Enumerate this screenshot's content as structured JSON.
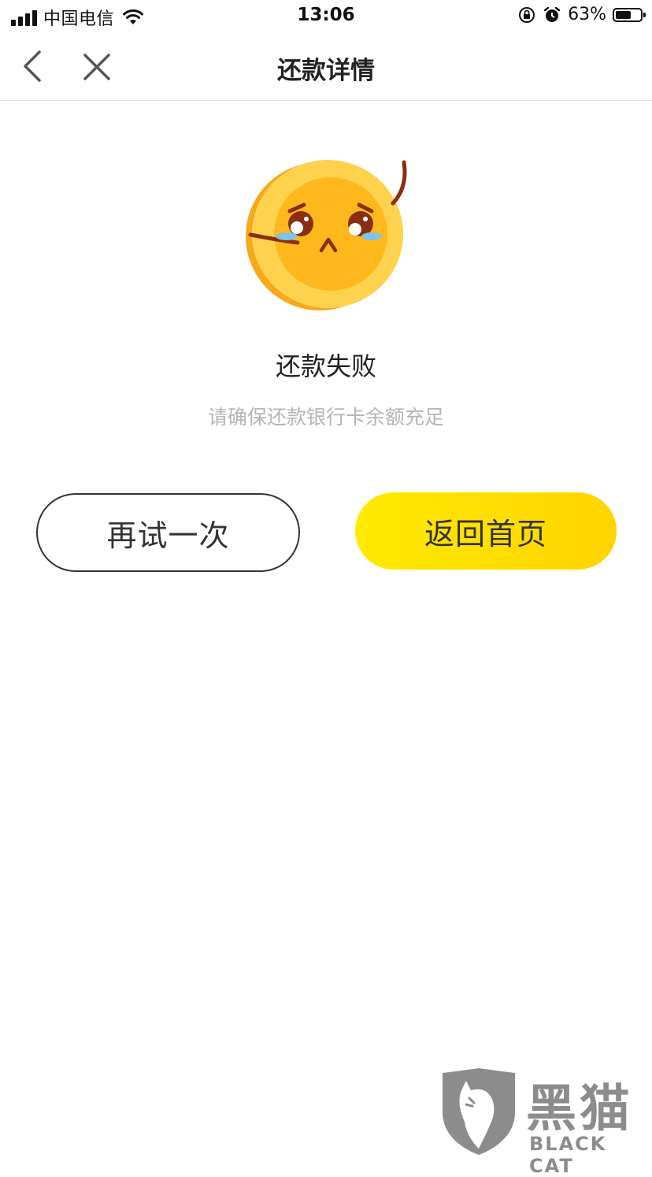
{
  "status_bar": {
    "carrier": "中国电信",
    "time": "13:06",
    "battery_percent": "63%",
    "battery_level": 0.63,
    "icons": [
      "signal-icon",
      "wifi-icon",
      "orientation-lock-icon",
      "alarm-icon",
      "battery-icon"
    ]
  },
  "nav": {
    "title": "还款详情",
    "back_icon": "chevron-left-icon",
    "close_icon": "close-icon"
  },
  "result": {
    "illustration": "crying-coin-icon",
    "title": "还款失败",
    "subtitle": "请确保还款银行卡余额充足"
  },
  "actions": {
    "retry_label": "再试一次",
    "home_label": "返回首页"
  },
  "watermark": {
    "text": "黑猫",
    "sub": "BLACK CAT"
  },
  "colors": {
    "accent_yellow": "#FFE100",
    "coin": "#FFB81C",
    "text_primary": "#222222",
    "text_secondary": "#B5B5B5"
  }
}
